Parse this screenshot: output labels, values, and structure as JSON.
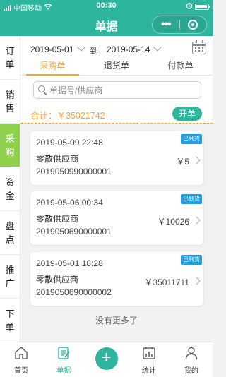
{
  "status": {
    "carrier": "中国移动",
    "time": "00:30"
  },
  "header": {
    "title": "单据",
    "more": "•••"
  },
  "sidebar": {
    "items": [
      {
        "chars": [
          "订",
          "单"
        ]
      },
      {
        "chars": [
          "销",
          "售"
        ]
      },
      {
        "chars": [
          "采",
          "购"
        ]
      },
      {
        "chars": [
          "资",
          "金"
        ]
      },
      {
        "chars": [
          "盘",
          "点"
        ]
      },
      {
        "chars": [
          "推",
          "广"
        ]
      },
      {
        "chars": [
          "下",
          "单"
        ]
      }
    ],
    "active_index": 2
  },
  "filter": {
    "start_date": "2019-05-01",
    "to_label": "到",
    "end_date": "2019-05-14"
  },
  "tabs": [
    "采购单",
    "退货单",
    "付款单"
  ],
  "search": {
    "placeholder": "单据号/供应商"
  },
  "summary": {
    "total_text": "合计：￥35021742",
    "open_button": "开单"
  },
  "orders": [
    {
      "datetime": "2019-05-09 22:48",
      "supplier": "零散供应商",
      "number": "2019050990000001",
      "amount": "￥5",
      "status": "已到货"
    },
    {
      "datetime": "2019-05-06 00:34",
      "supplier": "零散供应商",
      "number": "2019050690000001",
      "amount": "￥10026",
      "status": "已到货"
    },
    {
      "datetime": "2019-05-01 18:28",
      "supplier": "零散供应商",
      "number": "2019050690000002",
      "amount": "￥35011711",
      "status": "已到货"
    }
  ],
  "no_more": "没有更多了",
  "tabbar": [
    {
      "label": "首页",
      "icon": "home-icon"
    },
    {
      "label": "单据",
      "icon": "document-icon"
    },
    {
      "label": "",
      "icon": "plus-icon"
    },
    {
      "label": "统计",
      "icon": "chart-icon"
    },
    {
      "label": "我的",
      "icon": "user-icon"
    }
  ],
  "colors": {
    "accent": "#2db69d",
    "active_sidebar": "#8fd14a",
    "orange": "#f2a43a",
    "badge": "#1aa0e6"
  }
}
